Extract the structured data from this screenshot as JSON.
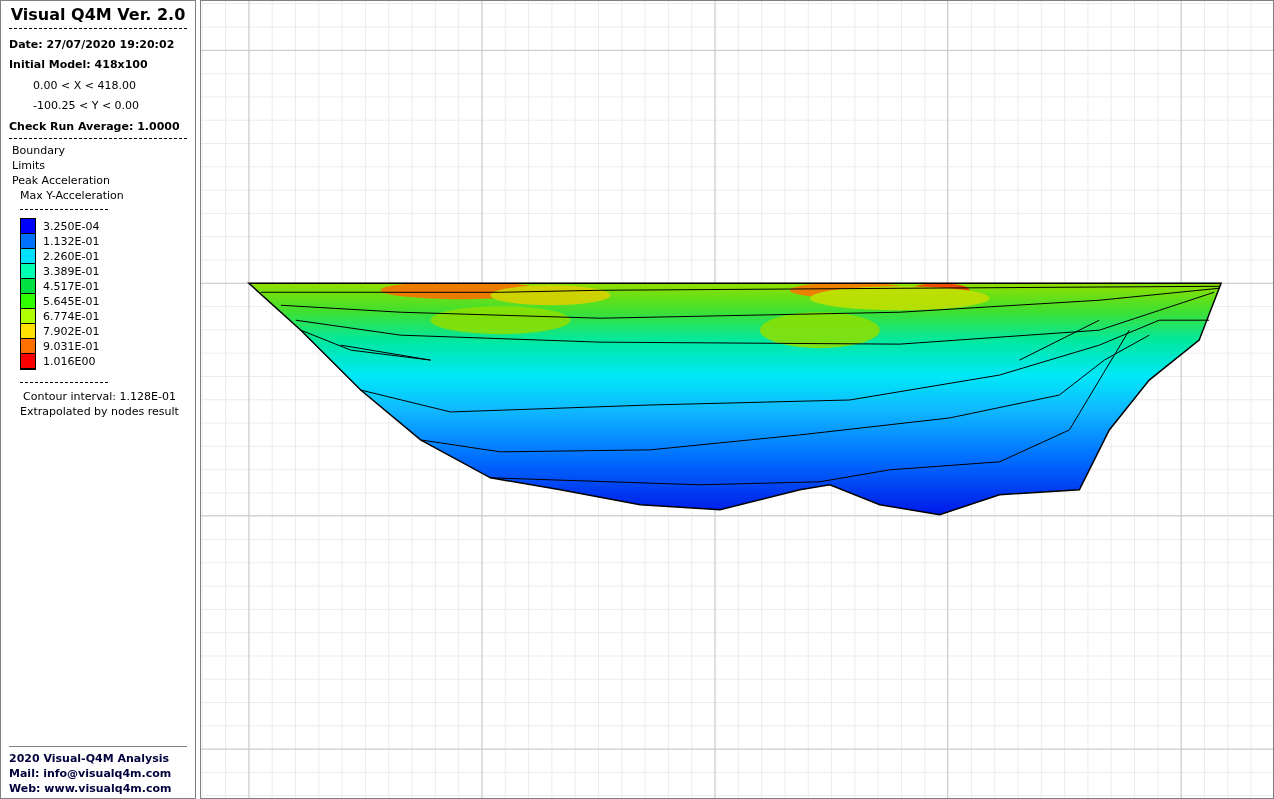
{
  "sidebar": {
    "title": "Visual Q4M Ver. 2.0",
    "date": "Date: 27/07/2020 19:20:02",
    "model": "Initial Model: 418x100",
    "x_range": "0.00 < X < 418.00",
    "y_range": "-100.25 < Y < 0.00",
    "check_run": "Check Run Average: 1.0000",
    "layers": [
      "Boundary",
      "Limits",
      "Peak Acceleration"
    ],
    "result": "Max Y-Acceleration",
    "legend": [
      {
        "label": "3.250E-04",
        "color": "#0000ff"
      },
      {
        "label": "1.132E-01",
        "color": "#0070ff"
      },
      {
        "label": "2.260E-01",
        "color": "#00e0ff"
      },
      {
        "label": "3.389E-01",
        "color": "#00ffb0"
      },
      {
        "label": "4.517E-01",
        "color": "#00e040"
      },
      {
        "label": "5.645E-01",
        "color": "#30ff00"
      },
      {
        "label": "6.774E-01",
        "color": "#b0ff00"
      },
      {
        "label": "7.902E-01",
        "color": "#ffe000"
      },
      {
        "label": "9.031E-01",
        "color": "#ff7000"
      },
      {
        "label": "1.016E00",
        "color": "#ff0000"
      }
    ],
    "contour_interval": "Contour interval: 1.128E-01",
    "note": "Extrapolated by nodes result",
    "footer": [
      "2020 Visual-Q4M Analysis",
      "Mail: info@visualq4m.com",
      "Web: www.visualq4m.com"
    ]
  }
}
